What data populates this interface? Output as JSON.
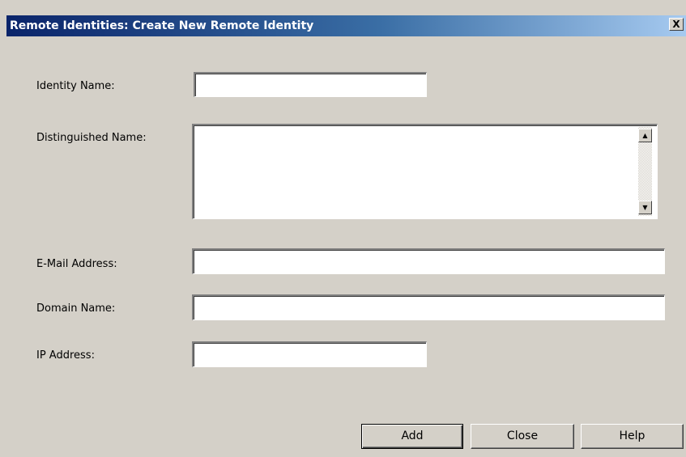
{
  "window": {
    "title": "Remote Identities: Create New Remote Identity",
    "close_glyph": "X"
  },
  "form": {
    "identity_name": {
      "label": "Identity Name:",
      "value": ""
    },
    "distinguished_name": {
      "label": "Distinguished Name:",
      "value": ""
    },
    "email_address": {
      "label": "E-Mail Address:",
      "value": ""
    },
    "domain_name": {
      "label": "Domain Name:",
      "value": ""
    },
    "ip_address": {
      "label": "IP Address:",
      "value": ""
    }
  },
  "scrollbar": {
    "up_glyph": "▲",
    "down_glyph": "▼"
  },
  "buttons": {
    "add": "Add",
    "close": "Close",
    "help": "Help"
  }
}
